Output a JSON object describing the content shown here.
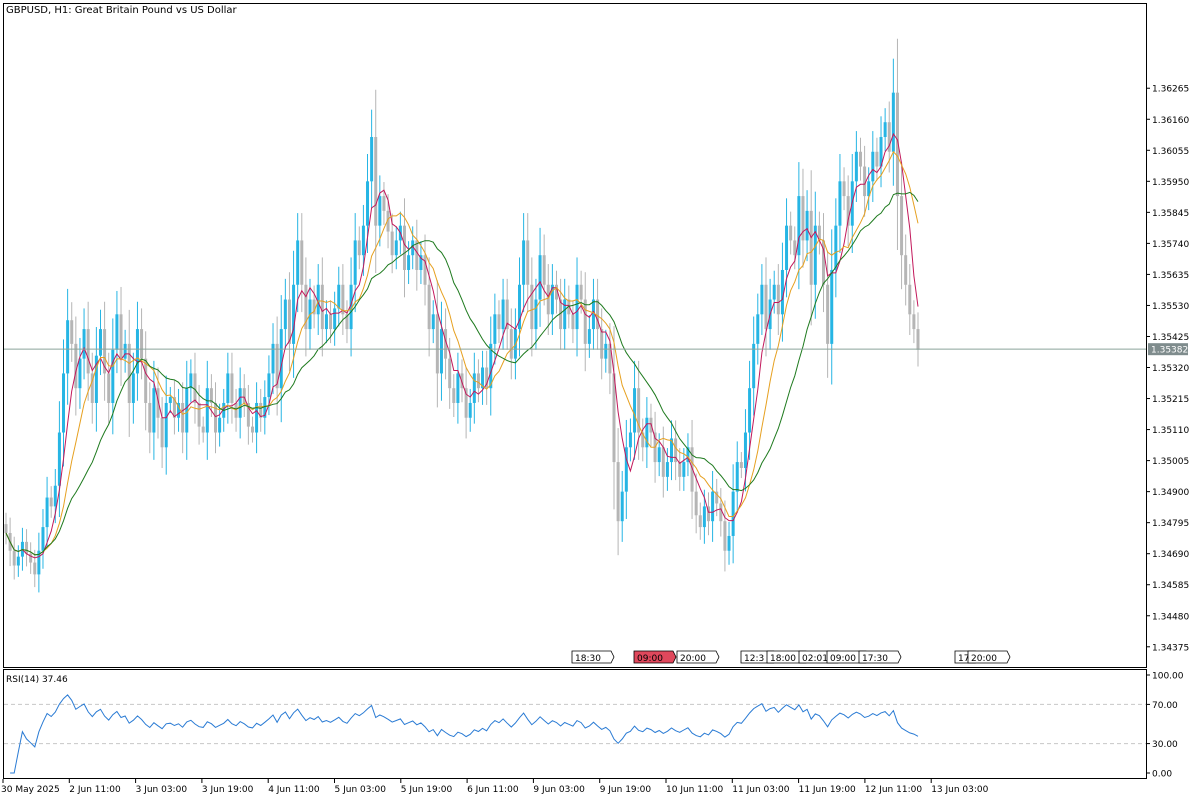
{
  "chart_data": {
    "type": "candlestick",
    "title": "GBPUSD, H1:  Great Britain Pound vs US Dollar",
    "symbol": "GBPUSD",
    "timeframe": "H1",
    "description": "Great Britain Pound vs US Dollar",
    "price_axis": {
      "ylim": [
        1.3431,
        1.3655
      ],
      "ticks": [
        "1.36265",
        "1.36160",
        "1.36055",
        "1.35950",
        "1.35845",
        "1.35740",
        "1.35635",
        "1.35530",
        "1.35425",
        "1.35320",
        "1.35215",
        "1.35110",
        "1.35005",
        "1.34900",
        "1.34795",
        "1.34690",
        "1.34585",
        "1.34480",
        "1.34375"
      ]
    },
    "current_price": "1.35382",
    "x_ticks": [
      "30 May 2025",
      "2 Jun 11:00",
      "3 Jun 03:00",
      "3 Jun 19:00",
      "4 Jun 11:00",
      "5 Jun 03:00",
      "5 Jun 19:00",
      "6 Jun 11:00",
      "9 Jun 03:00",
      "9 Jun 19:00",
      "10 Jun 11:00",
      "11 Jun 03:00",
      "11 Jun 19:00",
      "12 Jun 11:00",
      "13 Jun 03:00"
    ],
    "event_markers": [
      {
        "label": "18:30",
        "highlight": false
      },
      {
        "label": "09:00",
        "highlight": true
      },
      {
        "label": "20:00",
        "highlight": false
      },
      {
        "label": "12:3",
        "highlight": false
      },
      {
        "label": "18:00",
        "highlight": false
      },
      {
        "label": "02:01",
        "highlight": false
      },
      {
        "label": "09:00",
        "highlight": false
      },
      {
        "label": "17:30",
        "highlight": false
      },
      {
        "label": "17",
        "highlight": false
      },
      {
        "label": "20:00",
        "highlight": false
      }
    ],
    "closes": [
      1.3476,
      1.347,
      1.3465,
      1.3468,
      1.3473,
      1.3469,
      1.3466,
      1.3462,
      1.347,
      1.3478,
      1.3488,
      1.3485,
      1.3492,
      1.351,
      1.353,
      1.3548,
      1.354,
      1.3525,
      1.3535,
      1.3545,
      1.353,
      1.352,
      1.3536,
      1.3545,
      1.353,
      1.352,
      1.3538,
      1.355,
      1.3535,
      1.354,
      1.352,
      1.353,
      1.3545,
      1.3535,
      1.352,
      1.351,
      1.3525,
      1.3515,
      1.3505,
      1.352,
      1.3522,
      1.3515,
      1.352,
      1.351,
      1.3525,
      1.353,
      1.352,
      1.3512,
      1.351,
      1.3525,
      1.352,
      1.351,
      1.3515,
      1.352,
      1.353,
      1.352,
      1.3515,
      1.3525,
      1.352,
      1.3512,
      1.351,
      1.352,
      1.3515,
      1.3522,
      1.353,
      1.354,
      1.3525,
      1.3545,
      1.3555,
      1.354,
      1.356,
      1.3575,
      1.356,
      1.3545,
      1.3555,
      1.355,
      1.356,
      1.3545,
      1.355,
      1.3545,
      1.3552,
      1.356,
      1.355,
      1.3545,
      1.356,
      1.3575,
      1.357,
      1.358,
      1.3595,
      1.361,
      1.358,
      1.359,
      1.3585,
      1.3578,
      1.357,
      1.3575,
      1.358,
      1.3565,
      1.357,
      1.3575,
      1.3565,
      1.357,
      1.356,
      1.3545,
      1.355,
      1.353,
      1.3545,
      1.3535,
      1.3525,
      1.352,
      1.353,
      1.3525,
      1.3515,
      1.352,
      1.353,
      1.3525,
      1.3532,
      1.3525,
      1.354,
      1.355,
      1.3545,
      1.3555,
      1.3545,
      1.3535,
      1.3545,
      1.356,
      1.3575,
      1.356,
      1.3545,
      1.3555,
      1.357,
      1.356,
      1.355,
      1.356,
      1.3555,
      1.3545,
      1.3555,
      1.355,
      1.3545,
      1.356,
      1.3555,
      1.354,
      1.3545,
      1.3555,
      1.3545,
      1.3535,
      1.354,
      1.353,
      1.35,
      1.348,
      1.349,
      1.3505,
      1.351,
      1.3525,
      1.351,
      1.3505,
      1.3515,
      1.351,
      1.35,
      1.3505,
      1.3495,
      1.35,
      1.3508,
      1.35,
      1.3495,
      1.35,
      1.3505,
      1.349,
      1.3482,
      1.3478,
      1.3485,
      1.348,
      1.349,
      1.3486,
      1.348,
      1.347,
      1.3475,
      1.349,
      1.35,
      1.3498,
      1.351,
      1.3525,
      1.354,
      1.355,
      1.356,
      1.3545,
      1.3555,
      1.356,
      1.355,
      1.3565,
      1.358,
      1.3575,
      1.357,
      1.359,
      1.3575,
      1.3585,
      1.356,
      1.358,
      1.3575,
      1.356,
      1.354,
      1.3565,
      1.358,
      1.3595,
      1.359,
      1.358,
      1.3595,
      1.3605,
      1.36,
      1.359,
      1.3595,
      1.3605,
      1.36,
      1.361,
      1.3615,
      1.3605,
      1.3625,
      1.359,
      1.357,
      1.356,
      1.355,
      1.3545,
      1.3538
    ],
    "rsi": {
      "label": "RSI(14) 37.46",
      "period": 14,
      "value": 37.46,
      "ylim": [
        0,
        100
      ],
      "ticks": [
        "100.00",
        "70.00",
        "30.00",
        "0.00"
      ],
      "levels": [
        70,
        30
      ]
    },
    "moving_averages": [
      {
        "color": "#c2185b",
        "period": 5
      },
      {
        "color": "#e6a020",
        "period": 10
      },
      {
        "color": "#1e7a1e",
        "period": 20
      }
    ],
    "colors": {
      "bull": "#26b5e4",
      "bear": "#b5b5b5",
      "rsi_line": "#2a7bd4",
      "grid_level": "#c8c8c8",
      "price_line": "#8aa39a",
      "price_tag_bg": "#7f8c8d",
      "event_highlight": "#e0485c"
    }
  }
}
